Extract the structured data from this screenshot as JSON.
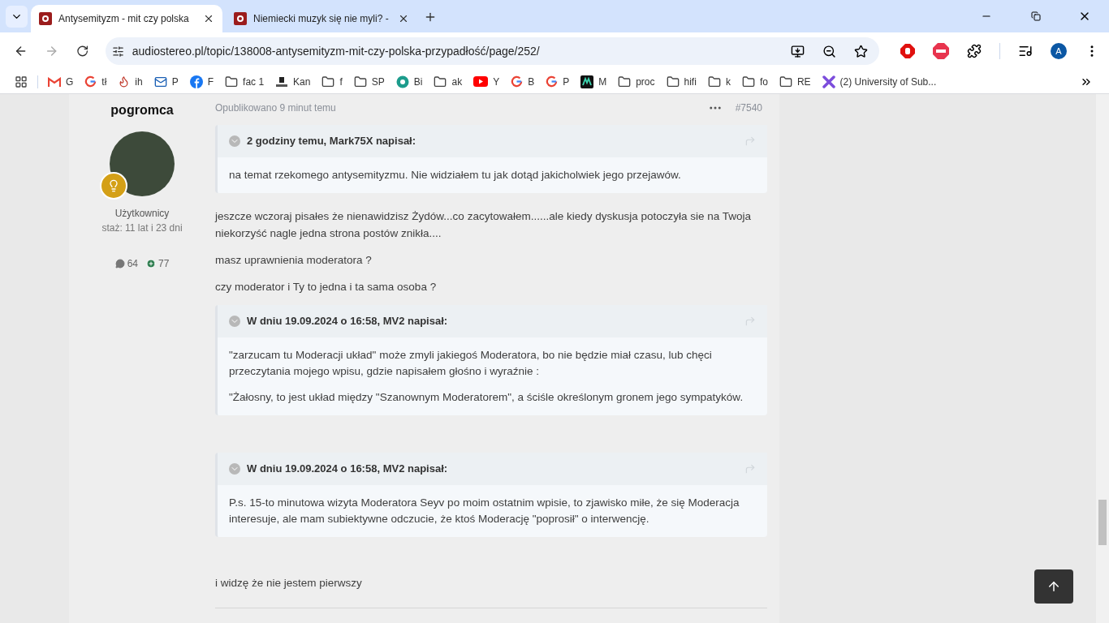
{
  "browser": {
    "tabs": [
      {
        "title": "Antysemityzm - mit czy polska",
        "selected": true
      },
      {
        "title": "Niemiecki muzyk się nie myli? -",
        "selected": false
      }
    ],
    "url": "audiostereo.pl/topic/138008-antysemityzm-mit-czy-polska-przypadłość/page/252/",
    "profile_initial": "A",
    "bookmarks": [
      {
        "label": "G",
        "kind": "gmail"
      },
      {
        "label": "tł",
        "kind": "google"
      },
      {
        "label": "ih",
        "kind": "flame"
      },
      {
        "label": "P",
        "kind": "mail"
      },
      {
        "label": "F",
        "kind": "facebook"
      },
      {
        "label": "fac 1",
        "kind": "folder"
      },
      {
        "label": "Kan",
        "kind": "kantor"
      },
      {
        "label": "f",
        "kind": "folder"
      },
      {
        "label": "SP",
        "kind": "folder"
      },
      {
        "label": "Bi",
        "kind": "disc"
      },
      {
        "label": "ak",
        "kind": "folder"
      },
      {
        "label": "Y",
        "kind": "youtube"
      },
      {
        "label": "B",
        "kind": "google"
      },
      {
        "label": "P",
        "kind": "google"
      },
      {
        "label": "M",
        "kind": "tile"
      },
      {
        "label": "proc",
        "kind": "folder"
      },
      {
        "label": "hifi",
        "kind": "folder"
      },
      {
        "label": "k",
        "kind": "folder"
      },
      {
        "label": "fo",
        "kind": "folder"
      },
      {
        "label": "RE",
        "kind": "folder"
      },
      {
        "label": "(2) University of Sub...",
        "kind": "cross"
      }
    ]
  },
  "post": {
    "author": "pogromca",
    "group": "Użytkownicy",
    "seniority": "staż: 11 lat i 23 dni",
    "posts": "64",
    "reputation": "77",
    "published": "Opublikowano 9 minut temu",
    "number": "#7540",
    "blocks": [
      {
        "kind": "quote",
        "header": "2 godziny temu, Mark75X napisał:",
        "paragraphs": [
          "na temat rzekomego antysemityzmu. Nie widziałem tu jak dotąd jakicholwiek jego przejawów."
        ]
      },
      {
        "kind": "paragraph",
        "text": "jeszcze wczoraj pisałes że nienawidzisz Żydów...co zacytowałem......ale kiedy dyskusja potoczyła sie na Twoja niekorzyść nagle jedna strona postów znikła...."
      },
      {
        "kind": "paragraph",
        "text": "masz uprawnienia moderatora ?"
      },
      {
        "kind": "paragraph",
        "text": "czy moderator i Ty to jedna i ta sama osoba ?"
      },
      {
        "kind": "quote",
        "header": "W dniu 19.09.2024 o 16:58, MV2 napisał:",
        "paragraphs": [
          "\"zarzucam tu Moderacji układ\" może zmyli jakiegoś Moderatora, bo nie będzie miał czasu, lub chęci przeczytania mojego wpisu, gdzie napisałem głośno i wyraźnie :",
          "\"Żałosny, to jest układ między \"Szanownym Moderatorem\", a ściśle określonym gronem jego sympatyków."
        ]
      },
      {
        "kind": "blank"
      },
      {
        "kind": "quote",
        "header": "W dniu 19.09.2024 o 16:58, MV2 napisał:",
        "paragraphs": [
          "P.s. 15-to minutowa wizyta Moderatora Seyv po moim ostatnim wpisie, to zjawisko miłe, że się Moderacja interesuje, ale mam subiektywne odczucie, że ktoś Moderację \"poprosił\" o interwencję."
        ]
      },
      {
        "kind": "blank"
      },
      {
        "kind": "paragraph",
        "text": "i widzę że nie jestem pierwszy"
      }
    ]
  }
}
